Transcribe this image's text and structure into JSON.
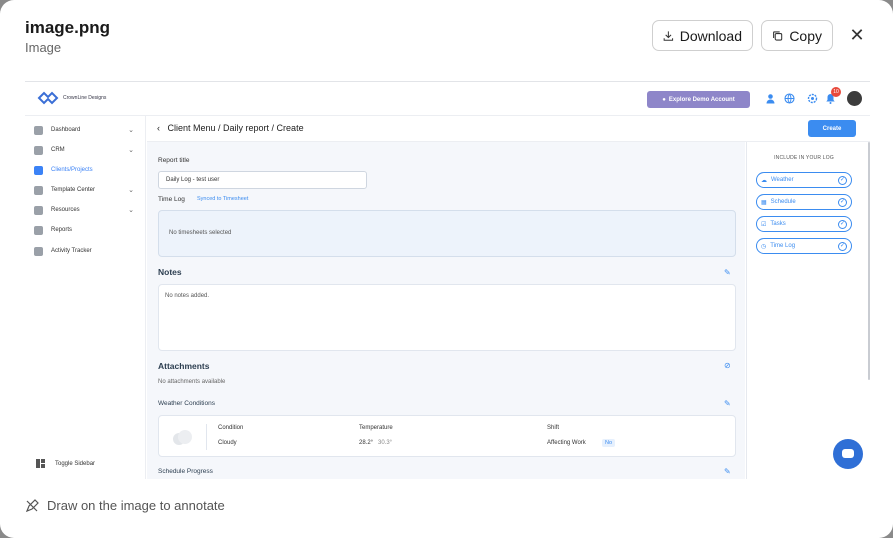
{
  "modal": {
    "title": "image.png",
    "subtitle": "Image",
    "download_label": "Download",
    "copy_label": "Copy",
    "footer_text": "Draw on the image to annotate"
  },
  "app": {
    "brand": "CrownLine Designs",
    "demo_label": "Explore Demo Account",
    "notification_count": "10",
    "sidebar": {
      "items": [
        {
          "label": "Dashboard",
          "icon": "dashboard-icon"
        },
        {
          "label": "CRM",
          "icon": "crm-icon"
        },
        {
          "label": "Clients/Projects",
          "icon": "clients-icon"
        },
        {
          "label": "Template Center",
          "icon": "template-icon"
        },
        {
          "label": "Resources",
          "icon": "resources-icon"
        },
        {
          "label": "Reports",
          "icon": "reports-icon"
        },
        {
          "label": "Activity Tracker",
          "icon": "activity-icon"
        }
      ],
      "toggle_label": "Toggle Sidebar"
    },
    "breadcrumb": "Client Menu / Daily report / Create",
    "create_label": "Create",
    "form": {
      "report_title_label": "Report title",
      "report_title_value": "Daily Log - test user",
      "time_log_label": "Time Log",
      "synced_label": "Synced to Timesheet",
      "no_timesheets": "No timesheets selected",
      "notes_heading": "Notes",
      "no_notes": "No notes added.",
      "attachments_heading": "Attachments",
      "no_attachments": "No attachments available",
      "weather_heading": "Weather Conditions",
      "weather": {
        "condition_label": "Condition",
        "condition_value": "Cloudy",
        "temperature_label": "Temperature",
        "temp_high": "28.2°",
        "temp_low": "30.3°",
        "shift_label": "Shift",
        "affecting_label": "Affecting Work",
        "affecting_value": "No"
      },
      "schedule_heading": "Schedule Progress"
    },
    "include_panel": {
      "title": "INCLUDE IN YOUR LOG",
      "items": [
        "Weather",
        "Schedule",
        "Tasks",
        "Time Log"
      ]
    },
    "accent_color": "#3b8cf0"
  }
}
